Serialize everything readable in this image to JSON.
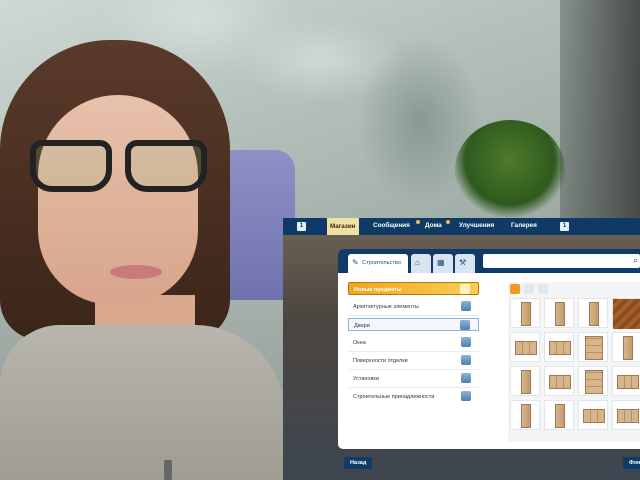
{
  "topbar": {
    "left_icon": "1",
    "shop": "Магазин",
    "messages": "Сообщения",
    "homes": "Дома",
    "upgrades": "Улучшения",
    "gallery": "Галерея",
    "right_icon": "1",
    "accent": "#103a66",
    "highlight": "#f1e0a6"
  },
  "panel": {
    "active_tab": "Строительство",
    "tab_icons": [
      "home-icon",
      "grid-icon",
      "tools-icon"
    ],
    "search_placeholder": "",
    "categories": [
      {
        "label": "Новые предметы",
        "icon": "new-items-icon",
        "highlighted": true
      },
      {
        "label": "Архитектурные элементы",
        "icon": "stairs-icon"
      },
      {
        "label": "Двери",
        "icon": "door-icon",
        "selected": true
      },
      {
        "label": "Окна",
        "icon": "window-icon"
      },
      {
        "label": "Поверхности отделки",
        "icon": "paint-icon"
      },
      {
        "label": "Установки",
        "icon": "gear-icon"
      },
      {
        "label": "Строительные принадлежности",
        "icon": "tools-icon"
      }
    ]
  },
  "buttons": {
    "back": "Назад",
    "bg": "Фон"
  }
}
